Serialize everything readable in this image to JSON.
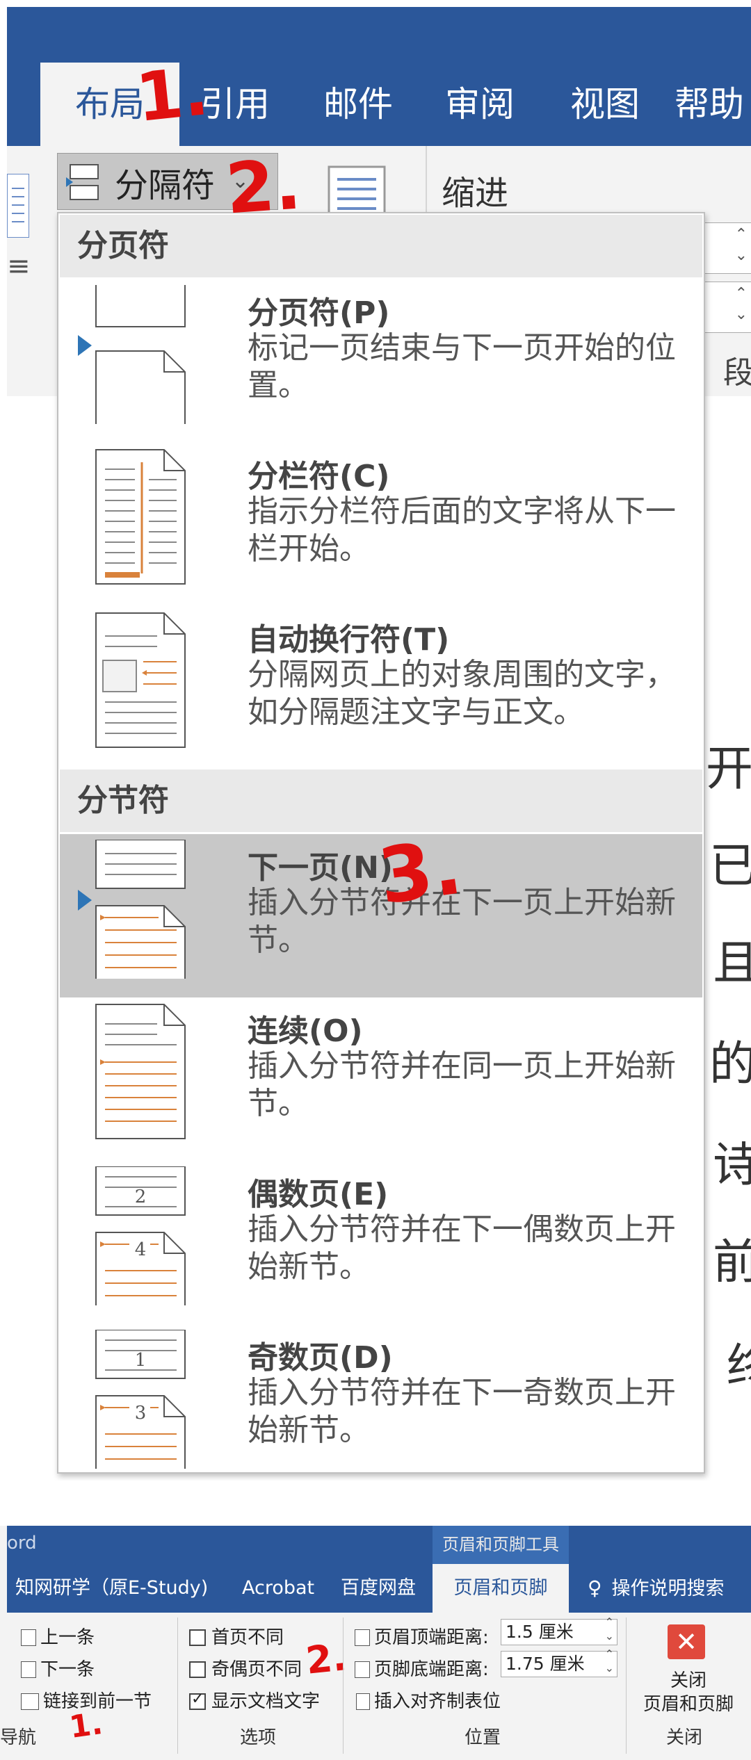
{
  "ribbon": {
    "tabs": [
      {
        "label": "布局",
        "active": true
      },
      {
        "label": "引用",
        "active": false
      },
      {
        "label": "邮件",
        "active": false
      },
      {
        "label": "审阅",
        "active": false
      },
      {
        "label": "视图",
        "active": false
      },
      {
        "label": "帮助",
        "active": false
      }
    ],
    "breaks_button": "分隔符",
    "indent_label": "缩进",
    "paragraph_fragment": "段"
  },
  "breaks_menu": {
    "page_breaks_header": "分页符",
    "section_breaks_header": "分节符",
    "items": [
      {
        "title": "分页符(P)",
        "desc": "标记一页结束与下一页开始的位置。"
      },
      {
        "title": "分栏符(C)",
        "desc": "指示分栏符后面的文字将从下一栏开始。"
      },
      {
        "title": "自动换行符(T)",
        "desc": "分隔网页上的对象周围的文字，如分隔题注文字与正文。"
      },
      {
        "title": "下一页(N)",
        "desc": "插入分节符并在下一页上开始新节。"
      },
      {
        "title": "连续(O)",
        "desc": "插入分节符并在同一页上开始新节。"
      },
      {
        "title": "偶数页(E)",
        "desc": "插入分节符并在下一偶数页上开始新节。"
      },
      {
        "title": "奇数页(D)",
        "desc": "插入分节符并在下一奇数页上开始新节。"
      }
    ],
    "even_icon_numbers": [
      "2",
      "4"
    ],
    "odd_icon_numbers": [
      "1",
      "3"
    ]
  },
  "annotations": {
    "top": [
      "1.",
      "2.",
      "3."
    ],
    "bottom": [
      "2.",
      "1."
    ]
  },
  "document_fragments": [
    "开",
    "已",
    "且",
    "的",
    "诗",
    "前",
    "终"
  ],
  "header_footer_ribbon": {
    "app_title_fragment": "ord",
    "tools_header": "页眉和页脚工具",
    "tabs": [
      {
        "label": "知网研学（原E-Study)",
        "active": false
      },
      {
        "label": "Acrobat",
        "active": false
      },
      {
        "label": "百度网盘",
        "active": false
      },
      {
        "label": "页眉和页脚",
        "active": true
      }
    ],
    "tell_me": "操作说明搜索",
    "navigation": {
      "prev": "上一条",
      "next": "下一条",
      "link_to_previous": "链接到前一节",
      "group_label": "导航"
    },
    "options": {
      "different_first_page": "首页不同",
      "different_odd_even": "奇偶页不同",
      "show_document_text": "显示文档文字",
      "group_label": "选项"
    },
    "position": {
      "header_from_top_label": "页眉顶端距离:",
      "header_from_top_value": "1.5 厘米",
      "footer_from_bottom_label": "页脚底端距离:",
      "footer_from_bottom_value": "1.75 厘米",
      "insert_alignment_tab": "插入对齐制表位",
      "group_label": "位置"
    },
    "close": {
      "button_label_1": "关闭",
      "button_label_2": "页眉和页脚",
      "group_label": "关闭"
    }
  },
  "colors": {
    "ribbon_blue": "#2b579a",
    "annotation_red": "#e01010",
    "selection_gray": "#c8c8c8",
    "close_red": "#e0493c"
  }
}
